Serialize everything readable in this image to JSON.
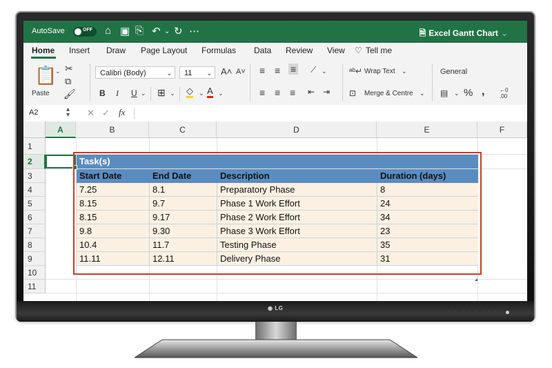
{
  "app": {
    "autosave_label": "AutoSave",
    "autosave_state": "OFF",
    "document_title": "Excel Gantt Chart",
    "brand_color": "#217346"
  },
  "monitor": {
    "brand": "LG"
  },
  "menu": {
    "tabs": [
      "Home",
      "Insert",
      "Draw",
      "Page Layout",
      "Formulas",
      "Data",
      "Review",
      "View"
    ],
    "tell_me": "Tell me",
    "active_tab": "Home"
  },
  "ribbon": {
    "paste_label": "Paste",
    "font_name": "Calibri (Body)",
    "font_size": "11",
    "wrap_text": "Wrap Text",
    "merge_centre": "Merge & Centre",
    "number_format": "General",
    "percent": "%",
    "comma": ",",
    "decimal_icon_text": "←0\n.00"
  },
  "formula_bar": {
    "name_box": "A2",
    "fx_label": "fx",
    "formula_value": ""
  },
  "grid": {
    "columns": [
      "A",
      "B",
      "C",
      "D",
      "E",
      "F"
    ],
    "selected_column": "A",
    "rows": [
      "1",
      "2",
      "3",
      "4",
      "5",
      "6",
      "7",
      "8",
      "9",
      "10",
      "11"
    ],
    "selected_row": "2"
  },
  "table": {
    "title": "Task(s)",
    "headers": [
      "Start Date",
      "End Date",
      "Description",
      "Duration (days)"
    ],
    "rows": [
      [
        "7.25",
        "8.1",
        "Preparatory Phase",
        "8"
      ],
      [
        "8.15",
        "9.7",
        "Phase 1 Work Effort",
        "24"
      ],
      [
        "8.15",
        "9.17",
        "Phase 2 Work Effort",
        "34"
      ],
      [
        "9.8",
        "9.30",
        "Phase 3 Work Effort",
        "23"
      ],
      [
        "10.4",
        "11.7",
        "Testing Phase",
        "35"
      ],
      [
        "11.11",
        "12.11",
        "Delivery Phase",
        "31"
      ]
    ],
    "header_color": "#5b8cc0",
    "row_color": "#fbf0e1",
    "highlight_color": "#d13a2a"
  }
}
